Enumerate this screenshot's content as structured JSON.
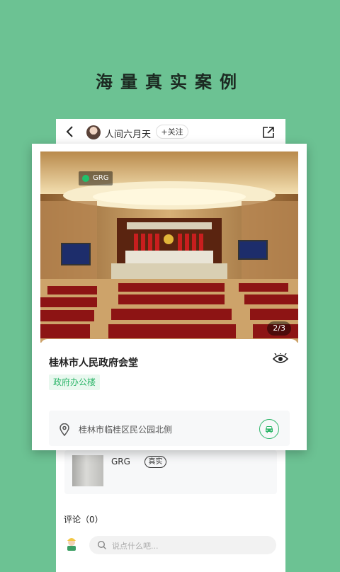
{
  "headline": "海量真实案例",
  "profile": {
    "username": "人间六月天",
    "follow_label": "+关注"
  },
  "case": {
    "title": "桂林市人民政府会堂",
    "category": "政府办公楼",
    "brand_tag": "GRG",
    "image_counter": "2/3",
    "address": "桂林市临桂区民公园北侧"
  },
  "related": {
    "title": "GRG",
    "badge": "真实"
  },
  "comments": {
    "label": "评论（0）",
    "placeholder": "说点什么吧..."
  },
  "icons": [
    "back-arrow-icon",
    "share-icon",
    "eye-icon",
    "location-pin-icon",
    "car-icon",
    "search-icon"
  ],
  "colors": {
    "background": "#6cc293",
    "accent": "#2fb66b",
    "tag_bg": "#e9f8ef"
  }
}
